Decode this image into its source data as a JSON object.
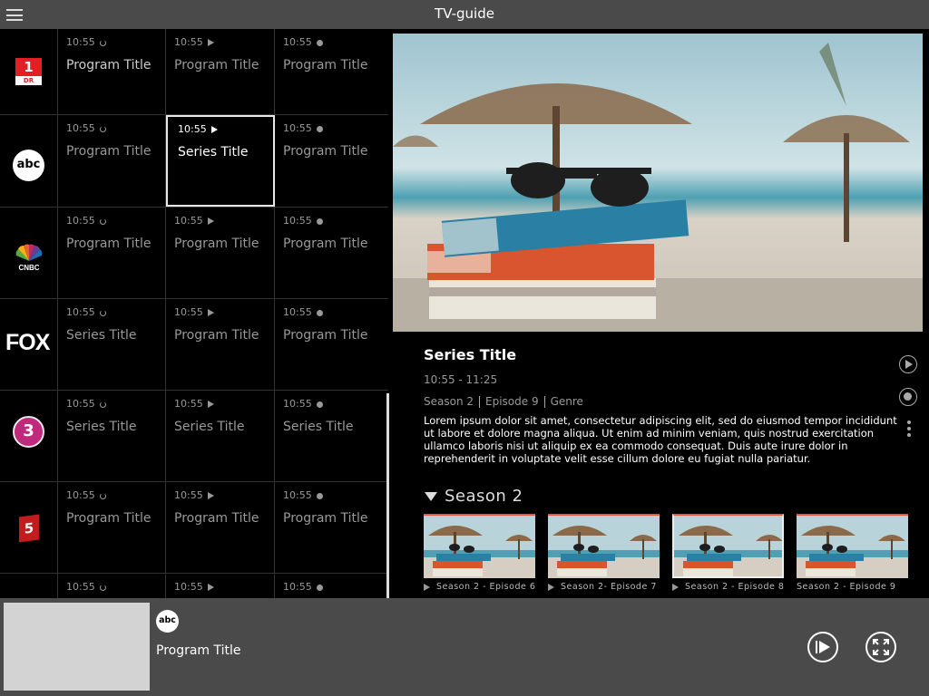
{
  "app": {
    "title": "TV-guide"
  },
  "guide": {
    "channels": [
      {
        "name": "DR1",
        "logo_text": "1",
        "logo_sub": "DR",
        "icon": "dr1-logo",
        "programs": [
          {
            "time": "10:55",
            "indicator": "replay",
            "title": "Program Title"
          },
          {
            "time": "10:55",
            "indicator": "play",
            "title": "Program Title"
          },
          {
            "time": "10:55",
            "indicator": "record",
            "title": "Program Title"
          }
        ]
      },
      {
        "name": "ABC",
        "logo_text": "abc",
        "icon": "abc-logo",
        "programs": [
          {
            "time": "10:55",
            "indicator": "replay",
            "title": "Program Title"
          },
          {
            "time": "10:55",
            "indicator": "play",
            "title": "Series Title",
            "selected": true
          },
          {
            "time": "10:55",
            "indicator": "record",
            "title": "Program Title"
          }
        ]
      },
      {
        "name": "CNBC",
        "logo_text": "CNBC",
        "icon": "cnbc-peacock-logo",
        "programs": [
          {
            "time": "10:55",
            "indicator": "replay",
            "title": "Program Title"
          },
          {
            "time": "10:55",
            "indicator": "play",
            "title": "Program Title"
          },
          {
            "time": "10:55",
            "indicator": "record",
            "title": "Program Title"
          }
        ]
      },
      {
        "name": "FOX",
        "logo_text": "FOX",
        "icon": "fox-logo",
        "programs": [
          {
            "time": "10:55",
            "indicator": "replay",
            "title": "Series Title"
          },
          {
            "time": "10:55",
            "indicator": "play",
            "title": "Program Title"
          },
          {
            "time": "10:55",
            "indicator": "record",
            "title": "Program Title"
          }
        ]
      },
      {
        "name": "TV3",
        "logo_text": "3",
        "icon": "tv3-logo",
        "programs": [
          {
            "time": "10:55",
            "indicator": "replay",
            "title": "Series Title"
          },
          {
            "time": "10:55",
            "indicator": "play",
            "title": "Series Title"
          },
          {
            "time": "10:55",
            "indicator": "record",
            "title": "Series Title"
          }
        ]
      },
      {
        "name": "Kanal 5",
        "logo_text": "5",
        "icon": "kanal5-logo",
        "programs": [
          {
            "time": "10:55",
            "indicator": "replay",
            "title": "Program Title"
          },
          {
            "time": "10:55",
            "indicator": "play",
            "title": "Program Title"
          },
          {
            "time": "10:55",
            "indicator": "record",
            "title": "Program Title"
          }
        ]
      },
      {
        "name": "",
        "logo_text": "",
        "icon": "",
        "programs": [
          {
            "time": "10:55",
            "indicator": "replay",
            "title": ""
          },
          {
            "time": "10:55",
            "indicator": "play",
            "title": ""
          },
          {
            "time": "10:55",
            "indicator": "record",
            "title": ""
          }
        ]
      }
    ]
  },
  "detail": {
    "hero_icon": "beach-books-sunglasses-image",
    "title": "Series Title",
    "time_range": "10:55 - 11:25",
    "season": "Season 2",
    "episode": "Episode 9",
    "genre": "Genre",
    "description": "Lorem ipsum dolor sit amet, consectetur adipiscing elit, sed do eiusmod tempor incididunt ut labore et dolore magna aliqua. Ut enim ad minim veniam, quis nostrud exercitation ullamco laboris nisi ut aliquip ex ea commodo consequat. Duis aute irure dolor in reprehenderit in voluptate velit esse cillum dolore eu fugiat nulla pariatur.",
    "season_header": "Season 2",
    "episodes": [
      {
        "label": "Season 2 - Episode 6",
        "play": true,
        "progress": 1.0
      },
      {
        "label": "Season 2- Episode 7",
        "play": true,
        "progress": 1.0
      },
      {
        "label": "Season 2 - Episode 8",
        "play": true,
        "selected": true,
        "progress": 1.0
      },
      {
        "label": "Season 2 - Episode 9",
        "play": false,
        "progress": 0
      }
    ]
  },
  "player": {
    "channel_logo": "abc",
    "program_title": "Program Title"
  },
  "colors": {
    "accent": "#e8553f",
    "bar": "#4a4a4a",
    "muted": "#999999"
  }
}
